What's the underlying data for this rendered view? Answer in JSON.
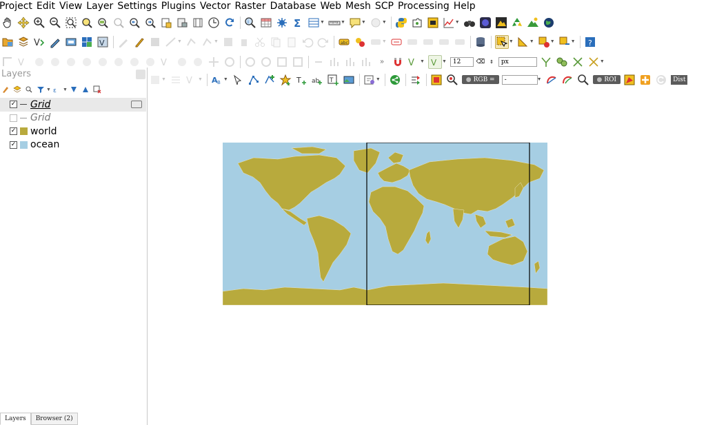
{
  "menubar": {
    "items": [
      "Project",
      "Edit",
      "View",
      "Layer",
      "Settings",
      "Plugins",
      "Vector",
      "Raster",
      "Database",
      "Web",
      "Mesh",
      "SCP",
      "Processing",
      "Help"
    ]
  },
  "toolbar_row1": {
    "icons": [
      "pan-icon",
      "pan-to-selection-icon",
      "zoom-in-icon",
      "zoom-out-icon",
      "zoom-full-icon",
      "zoom-to-selection-icon",
      "zoom-to-layer-icon",
      "zoom-native-icon",
      "zoom-last-icon",
      "zoom-next-icon",
      "new-bookmark-icon",
      "show-bookmarks-icon",
      "temporal-controller-icon",
      "refresh-icon",
      "identify-icon",
      "attribute-table-icon",
      "statistics-icon",
      "sum-icon",
      "field-calculator-icon",
      "measure-icon",
      "map-tips-icon",
      "text-annotation-icon",
      "python-icon",
      "plugin-icon",
      "scp-icon",
      "chart-icon",
      "binoculars-icon",
      "qgis-cloud-icon",
      "layer-tool-icon",
      "recycle-icon",
      "mountain-icon",
      "globe-icon"
    ]
  },
  "toolbar_row2": {
    "icons": [
      "open-project-icon",
      "new-layer-icon",
      "add-vector-icon",
      "digitize-icon",
      "add-delimited-icon",
      "add-raster-icon",
      "add-wms-icon",
      "pencil-icon",
      "edit-icon",
      "save-edits-icon",
      "digitize-line-icon",
      "vertex-tool-icon",
      "modify-icon",
      "delete-icon",
      "cut-icon",
      "copy-icon",
      "paste-icon",
      "undo-icon",
      "redo-icon",
      "label-icon",
      "label-pin-icon",
      "label-move-icon",
      "label-show-icon",
      "label-rotate-icon",
      "label-change-icon",
      "label-preview-icon",
      "db-icon",
      "select-feature-icon",
      "select-area-icon",
      "deselect-icon",
      "select-value-icon",
      "help-icon"
    ]
  },
  "toolbar_row3": {
    "icons": [
      "advanced-digitize-icon",
      "rotate-feature-icon",
      "simplify-icon",
      "add-ring-icon",
      "add-part-icon",
      "fill-ring-icon",
      "delete-ring-icon",
      "delete-part-icon",
      "reshape-icon",
      "offset-curve-icon",
      "split-features-icon",
      "split-parts-icon",
      "merge-features-icon",
      "merge-attributes-icon",
      "rotate-symbols-icon",
      "more-icon",
      "magnet-icon",
      "snapping-icon"
    ],
    "tolerance_value": "12",
    "unit_value": "px"
  },
  "toolbar_row4": {
    "rgb_label": "RGB =",
    "rgb_value": "-",
    "roi_label": "ROI",
    "dist_label": "Dist"
  },
  "layers_panel": {
    "title": "Layers",
    "layers": [
      {
        "name": "Grid",
        "checked": true,
        "style": "line",
        "selected": true
      },
      {
        "name": "Grid",
        "checked": false,
        "style": "line-off",
        "selected": false
      },
      {
        "name": "world",
        "checked": true,
        "style": "fill",
        "color": "#b8aa3d",
        "selected": false
      },
      {
        "name": "ocean",
        "checked": true,
        "style": "fill",
        "color": "#a6cee3",
        "selected": false
      }
    ],
    "tabs": [
      "Layers",
      "Browser (2)"
    ]
  },
  "map": {
    "ocean_color": "#a6cee3",
    "land_color": "#b8aa3d",
    "grid_color": "#000000"
  }
}
